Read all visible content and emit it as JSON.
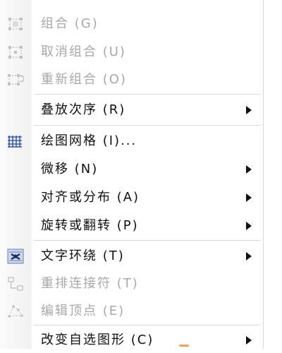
{
  "menu": {
    "items": [
      {
        "label": "组合 (G)",
        "icon": "group-icon",
        "disabled": true,
        "submenu": false
      },
      {
        "label": "取消组合 (U)",
        "icon": "ungroup-icon",
        "disabled": true,
        "submenu": false
      },
      {
        "label": "重新组合 (O)",
        "icon": "regroup-icon",
        "disabled": true,
        "submenu": false
      },
      {
        "label": "叠放次序 (R)",
        "icon": null,
        "disabled": false,
        "submenu": true
      },
      {
        "label": "绘图网格 (I)...",
        "icon": "grid-icon",
        "disabled": false,
        "submenu": false
      },
      {
        "label": "微移 (N)",
        "icon": null,
        "disabled": false,
        "submenu": true
      },
      {
        "label": "对齐或分布 (A)",
        "icon": null,
        "disabled": false,
        "submenu": true
      },
      {
        "label": "旋转或翻转 (P)",
        "icon": null,
        "disabled": false,
        "submenu": true
      },
      {
        "label": "文字环绕 (T)",
        "icon": "text-wrap-icon",
        "disabled": false,
        "submenu": true
      },
      {
        "label": "重排连接符 (T)",
        "icon": "reroute-connectors-icon",
        "disabled": true,
        "submenu": false
      },
      {
        "label": "编辑顶点 (E)",
        "icon": "edit-points-icon",
        "disabled": true,
        "submenu": false
      },
      {
        "label": "改变自选图形 (C)",
        "icon": null,
        "disabled": false,
        "submenu": true
      }
    ]
  },
  "colors": {
    "text": "#111111",
    "disabled_text": "#a8a8a8",
    "grid_icon": "#3b5bb5"
  }
}
